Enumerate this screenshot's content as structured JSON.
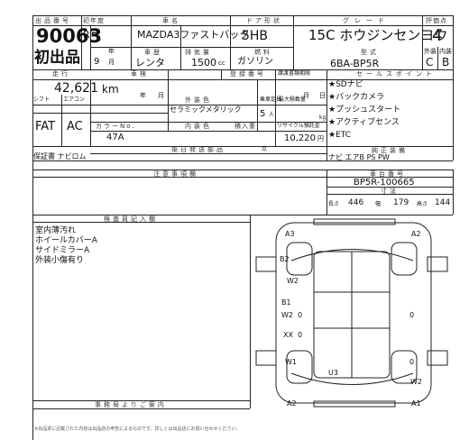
{
  "header": {
    "lot_no_label": "出品番号",
    "lot_no": "90063",
    "first_reg_label": "初年度",
    "era": "R",
    "year": "5",
    "year_unit": "年",
    "month": "9",
    "month_unit": "月",
    "first_listing": "初出品",
    "model_name_label": "車名",
    "model_name": "MAZDA3ファストバック",
    "usage_label": "車歴",
    "usage": "レンタ",
    "displacement_label": "排気量",
    "displacement": "1500",
    "displacement_unit": "cc",
    "body_label": "ドア形状",
    "body": "5HB",
    "fuel_label": "燃料",
    "fuel": "ガソリン",
    "grade_label": "グレード",
    "grade": "15C ホウジンセンヨウ",
    "model_code_label": "型式",
    "model_code": "6BA-BP5R",
    "score_label": "評価点",
    "score": "4",
    "exterior_label": "外装",
    "interior_label": "内装",
    "exterior_grade": "C",
    "interior_grade": "B"
  },
  "details": {
    "mileage_label": "走行",
    "mileage": "42,621",
    "mileage_unit": "km",
    "inspection_label": "車検",
    "inspection_y": "年",
    "inspection_m": "月",
    "plate_label": "登録番号",
    "recycle_date_label": "譲渡書類期限",
    "recycle_m": "月",
    "recycle_d": "日",
    "shift_label": "シフト",
    "ac_label": "エアコン",
    "shift": "FAT",
    "ac": "AC",
    "ext_color_label": "外装色",
    "ext_color": "セラミックメタリック",
    "color_no_label": "カラーNo.",
    "color_no": "47A",
    "int_color_label": "内装色",
    "seats_label": "乗車定員",
    "seats": "5",
    "seats_unit": "人",
    "max_load_label": "最大積載量",
    "load_unit": "kg",
    "cargo_label": "積入重",
    "recycle_fee_label": "リサイクル預託金",
    "recycle_fee": "10,220",
    "recycle_fee_unit": "円",
    "later_parts_label": "後日発送部品",
    "later_parts_mark": "点",
    "docs": "保証書 ナビロム"
  },
  "sales_points": {
    "label": "セールスポイント",
    "items": [
      "★SDナビ",
      "★バックカメラ",
      "★プッシュスタート",
      "★アクティブセンス",
      "★ETC"
    ]
  },
  "equipment": {
    "label": "純正装備",
    "value": "ナビ エアB PS PW"
  },
  "frame": {
    "label": "車台番号",
    "value": "BP5R-100665",
    "dims_label": "寸法",
    "length_label": "長さ",
    "length": "446",
    "width_label": "幅",
    "width": "179",
    "height_label": "高さ",
    "height": "144"
  },
  "notes": {
    "label": "注意事項欄"
  },
  "inspector": {
    "label": "検査員記入欄",
    "lines": [
      "室内薄汚れ",
      "ホイールカバーA",
      "サイドミラーA",
      "外装小傷有り"
    ]
  },
  "office_label": "事務局よりご案内",
  "diagram": {
    "marks": [
      "A3",
      "A2",
      "B2",
      "W2",
      "B1",
      "W2",
      "XX",
      "W1",
      "U3",
      "W2",
      "A2",
      "A1"
    ],
    "zeros": [
      "0",
      "0",
      "0",
      "0"
    ]
  },
  "footer": "※出品票に記載された内容は出品店の申告によるものです。詳しくは出品店にお問い合わせください。"
}
